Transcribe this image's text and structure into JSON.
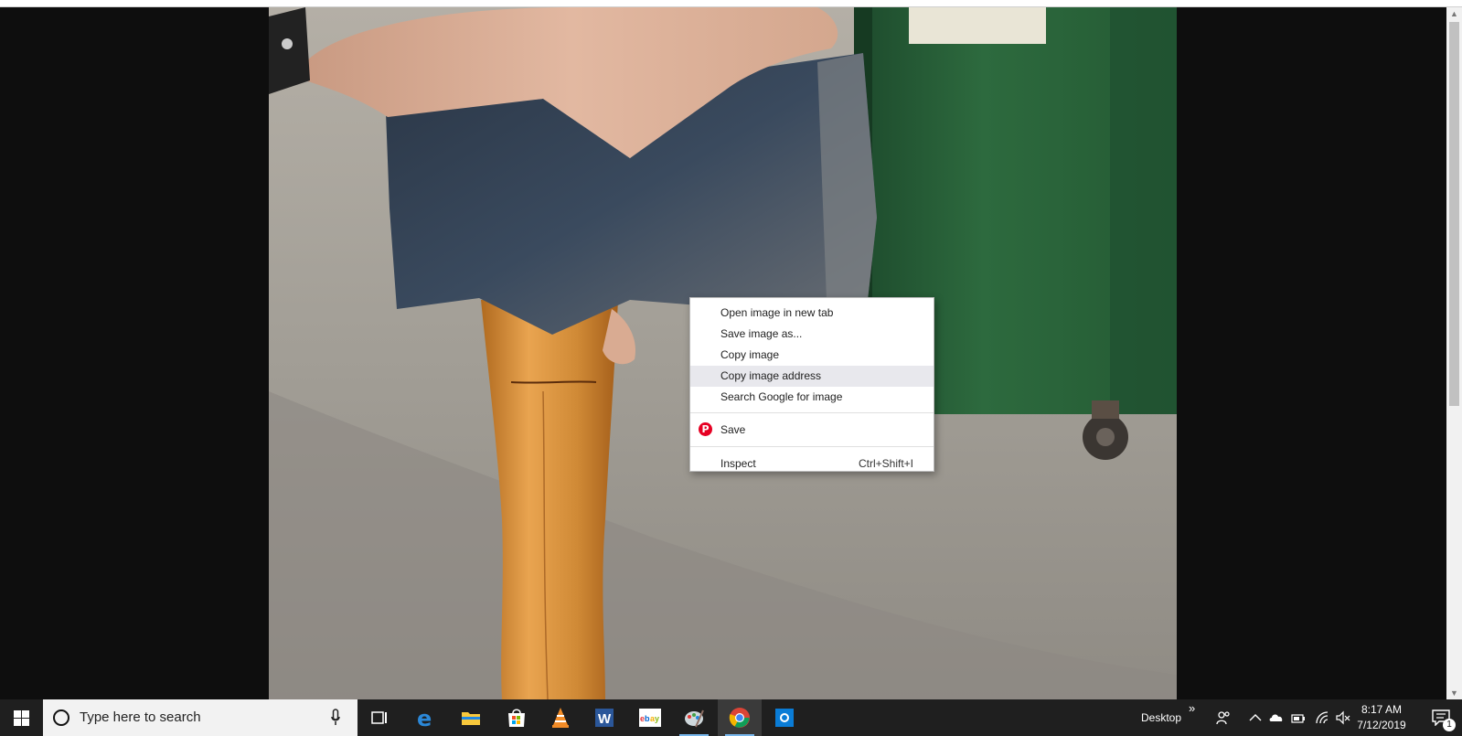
{
  "context_menu": {
    "items": [
      {
        "label": "Open image in new tab"
      },
      {
        "label": "Save image as..."
      },
      {
        "label": "Copy image"
      },
      {
        "label": "Copy image address"
      },
      {
        "label": "Search Google for image"
      }
    ],
    "pinterest": {
      "label": "Save",
      "icon": "pinterest-icon"
    },
    "inspect": {
      "label": "Inspect",
      "shortcut": "Ctrl+Shift+I"
    }
  },
  "taskbar": {
    "search_placeholder": "Type here to search",
    "apps": [
      "task-view-icon",
      "edge-icon",
      "file-explorer-icon",
      "store-icon",
      "vlc-icon",
      "word-icon",
      "ebay-icon",
      "paint-icon",
      "chrome-icon",
      "outlook-icon"
    ],
    "toolbar_label": "Desktop",
    "toolbar_chevron": "»",
    "clock": {
      "time": "8:17 AM",
      "date": "7/12/2019"
    },
    "notification_count": "1"
  },
  "colors": {
    "taskbar": "#1f1f1f",
    "accent": "#78b7ec",
    "pinterest": "#e60023"
  }
}
